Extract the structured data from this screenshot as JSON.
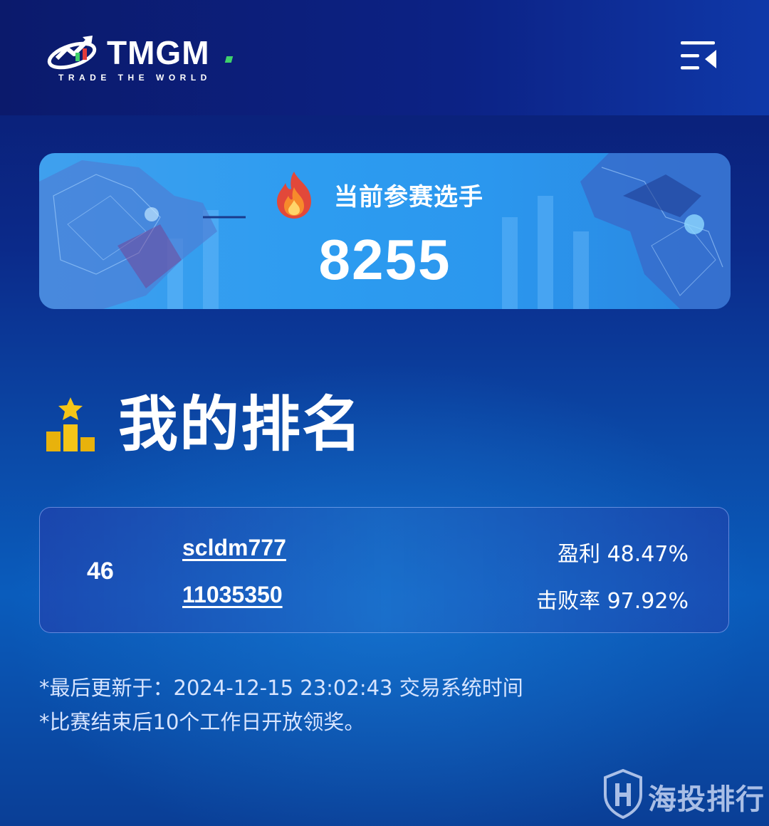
{
  "header": {
    "logo_text": "TMGM",
    "logo_tagline": "TRADE THE WORLD",
    "menu_icon": "menu-collapse-icon"
  },
  "banner": {
    "title": "当前参赛选手",
    "count": "8255",
    "icon": "fire-icon"
  },
  "ranking": {
    "title": "我的排名",
    "icon": "podium-star-icon",
    "entry": {
      "rank": "46",
      "username": "scldm777",
      "account": "11035350",
      "profit": "盈利 48.47%",
      "beat_rate": "击败率 97.92%"
    }
  },
  "notes": {
    "last_updated": "*最后更新于：2024-12-15 23:02:43 交易系统时间",
    "prize_notice": "*比赛结束后10个工作日开放领奖。"
  },
  "watermark": {
    "text": "海投排行",
    "icon": "shield-h-icon"
  },
  "colors": {
    "background": "#0b2a8a",
    "banner": "#2d9cf0",
    "accent_green": "#3fd16b",
    "gold": "#f5c518"
  }
}
